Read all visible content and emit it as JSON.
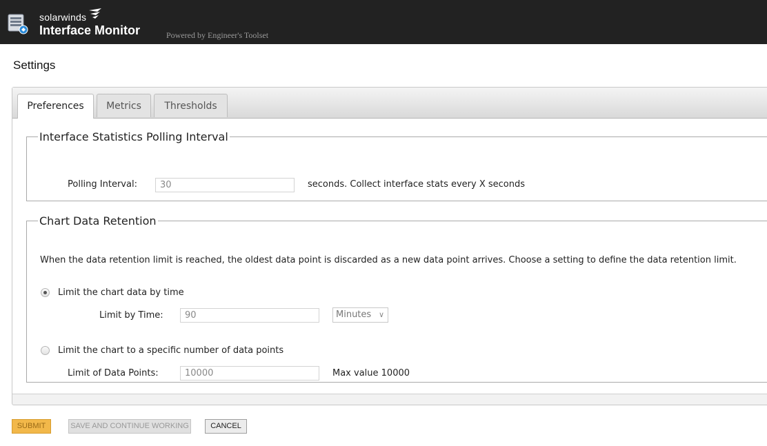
{
  "header": {
    "brand_small": "solarwinds",
    "app_title": "Interface Monitor",
    "powered_by": "Powered by Engineer's Toolset"
  },
  "page_title": "Settings",
  "tabs": [
    {
      "label": "Preferences",
      "active": true
    },
    {
      "label": "Metrics",
      "active": false
    },
    {
      "label": "Thresholds",
      "active": false
    }
  ],
  "polling": {
    "legend": "Interface Statistics Polling Interval",
    "label": "Polling Interval:",
    "value": "30",
    "hint": "seconds. Collect interface stats every X seconds"
  },
  "retention": {
    "legend": "Chart Data Retention",
    "description": "When the data retention limit is reached, the oldest data point is discarded as a new data point arrives. Choose a setting to define the data retention limit.",
    "option_time": {
      "label": "Limit the chart data by time",
      "selected": true
    },
    "time_label": "Limit by Time:",
    "time_value": "90",
    "time_unit": "Minutes",
    "option_points": {
      "label": "Limit the chart to a specific number of data points",
      "selected": false
    },
    "points_label": "Limit of Data Points:",
    "points_value": "10000",
    "points_hint": "Max value 10000"
  },
  "buttons": {
    "submit": "SUBMIT",
    "save_continue": "SAVE AND CONTINUE WORKING",
    "cancel": "CANCEL"
  },
  "colors": {
    "topbar": "#222222",
    "submit_button": "#f2b84a"
  }
}
